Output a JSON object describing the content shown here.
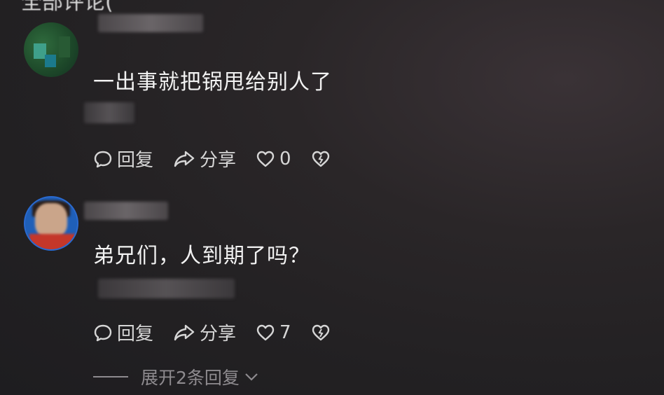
{
  "header": {
    "partial_title": "全部评论("
  },
  "comments": [
    {
      "text": "一出事就把锅甩给别人了",
      "actions": {
        "reply_label": "回复",
        "share_label": "分享",
        "like_count": "0"
      },
      "icons": [
        "comment-bubble-icon",
        "share-arrow-icon",
        "heart-icon",
        "broken-heart-icon"
      ]
    },
    {
      "text": "弟兄们，人到期了吗？",
      "actions": {
        "reply_label": "回复",
        "share_label": "分享",
        "like_count": "7"
      },
      "icons": [
        "comment-bubble-icon",
        "share-arrow-icon",
        "heart-icon",
        "broken-heart-icon"
      ]
    }
  ],
  "replies_toggle": {
    "label": "展开2条回复"
  },
  "colors": {
    "background": "#232123",
    "text": "#f2f2f2",
    "muted": "#8e8b8f"
  }
}
